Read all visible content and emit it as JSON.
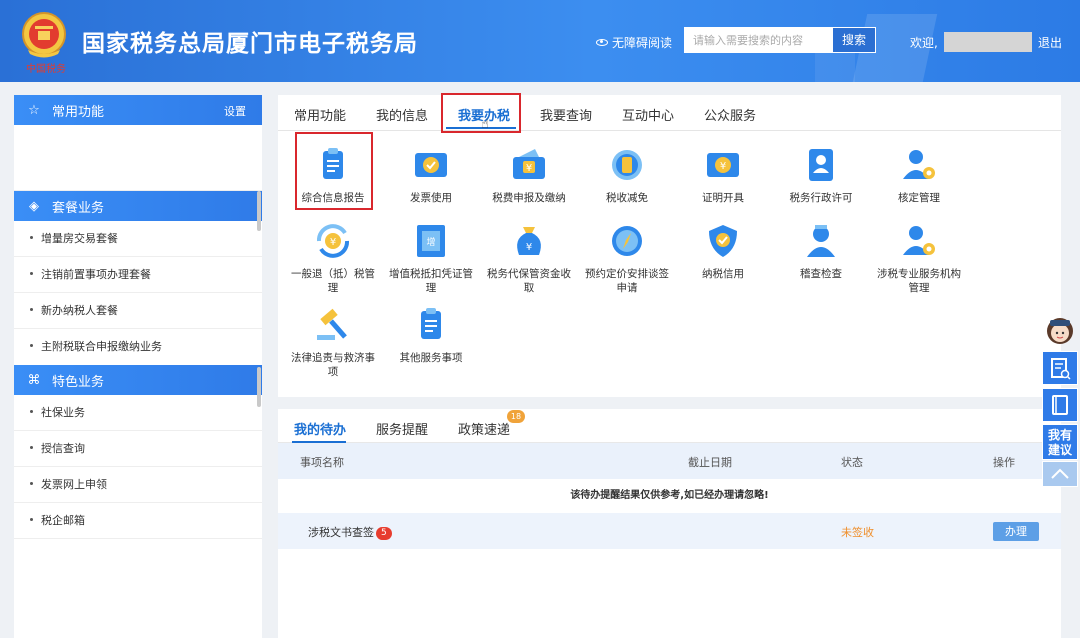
{
  "header": {
    "site_title": "国家税务总局厦门市电子税务局",
    "accessibility": "无障碍阅读",
    "search_placeholder": "请输入需要搜索的内容",
    "search_button": "搜索",
    "welcome": "欢迎,",
    "logout": "退出",
    "colors": {
      "bar": "#2c7be5",
      "highlight": "#d9272d"
    }
  },
  "sidebar": {
    "common": {
      "title": "常用功能",
      "settings": "设置",
      "icon": "star-icon"
    },
    "package": {
      "title": "套餐业务",
      "icon": "layers-icon",
      "items": [
        "增量房交易套餐",
        "注销前置事项办理套餐",
        "新办纳税人套餐",
        "主附税联合申报缴纳业务"
      ]
    },
    "feature": {
      "title": "特色业务",
      "icon": "grid-icon",
      "items": [
        "社保业务",
        "授信查询",
        "发票网上申领",
        "税企邮箱"
      ]
    }
  },
  "main": {
    "tabs": [
      "常用功能",
      "我的信息",
      "我要办税",
      "我要查询",
      "互动中心",
      "公众服务"
    ],
    "active_tab": "我要办税",
    "services": [
      {
        "label": "综合信息报告",
        "icon": "clipboard-icon"
      },
      {
        "label": "发票使用",
        "icon": "invoice-check-icon"
      },
      {
        "label": "税费申报及缴纳",
        "icon": "wallet-icon"
      },
      {
        "label": "税收减免",
        "icon": "coins-icon"
      },
      {
        "label": "证明开具",
        "icon": "certificate-icon"
      },
      {
        "label": "税务行政许可",
        "icon": "id-card-icon"
      },
      {
        "label": "核定管理",
        "icon": "user-gear-icon"
      },
      {
        "label": "一般退（抵）税管理",
        "icon": "refund-cycle-icon"
      },
      {
        "label": "增值税抵扣凭证管理",
        "icon": "ticket-icon"
      },
      {
        "label": "税务代保管资金收取",
        "icon": "money-bag-icon"
      },
      {
        "label": "预约定价安排谈签申请",
        "icon": "compass-icon"
      },
      {
        "label": "纳税信用",
        "icon": "shield-check-icon"
      },
      {
        "label": "稽查检查",
        "icon": "inspector-icon"
      },
      {
        "label": "涉税专业服务机构管理",
        "icon": "user-gear-icon"
      },
      {
        "label": "法律追责与救济事项",
        "icon": "gavel-icon"
      },
      {
        "label": "其他服务事项",
        "icon": "clipboard-icon"
      }
    ]
  },
  "todo": {
    "tabs": [
      "我的待办",
      "服务提醒",
      "政策速递"
    ],
    "policy_badge": "18",
    "columns": [
      "事项名称",
      "截止日期",
      "状态",
      "操作"
    ],
    "notice": "该待办提醒结果仅供参考,如已经办理请忽略!",
    "rows": [
      {
        "name": "涉税文书查签",
        "count": "5",
        "deadline": "",
        "status": "未签收",
        "action": "办理"
      }
    ]
  },
  "float": {
    "suggest": "我有建议"
  }
}
